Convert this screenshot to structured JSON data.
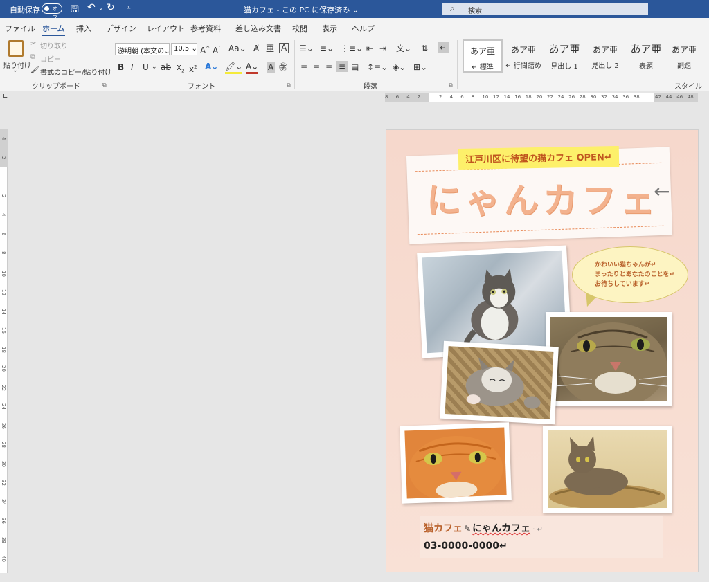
{
  "titlebar": {
    "autosave_label": "自動保存",
    "autosave_toggle": "オフ",
    "document_title": "猫カフェ - この PC に保存済み ⌄",
    "search_placeholder": "検索"
  },
  "tabs": [
    "ファイル",
    "ホーム",
    "挿入",
    "デザイン",
    "レイアウト",
    "参考資料",
    "差し込み文書",
    "校閲",
    "表示",
    "ヘルプ"
  ],
  "ribbon": {
    "clipboard": {
      "paste": "貼り付け",
      "cut": "切り取り",
      "copy": "コピー",
      "format_painter": "書式のコピー/貼り付け",
      "group_label": "クリップボード"
    },
    "font": {
      "font_name": "游明朝 (本文の⌄",
      "font_size": "10.5 ⌄",
      "group_label": "フォント"
    },
    "paragraph": {
      "group_label": "段落"
    },
    "styles": {
      "group_label": "スタイル",
      "items": [
        {
          "preview": "あア亜",
          "name": "↵ 標準"
        },
        {
          "preview": "あア亜",
          "name": "↵ 行間詰め"
        },
        {
          "preview": "あア亜",
          "name": "見出し 1"
        },
        {
          "preview": "あア亜",
          "name": "見出し 2"
        },
        {
          "preview": "あア亜",
          "name": "表題"
        },
        {
          "preview": "あア亜",
          "name": "副題"
        }
      ]
    }
  },
  "document": {
    "subtitle": "江戸川区に待望の猫カフェ OPEN↵",
    "main_title": "にゃんカフェ",
    "speech_bubble": [
      "かわいい猫ちゃんが↵",
      "まったりとあなたのことを↵",
      "お待ちしています↵"
    ],
    "shop_label": "猫カフェ",
    "shop_name": "にゃんカフェ",
    "phone": "03-0000-0000↵"
  },
  "ruler": {
    "horizontal": [
      "8",
      "6",
      "4",
      "2",
      "",
      "2",
      "4",
      "6",
      "8",
      "10",
      "12",
      "14",
      "16",
      "18",
      "20",
      "22",
      "24",
      "26",
      "28",
      "30",
      "32",
      "34",
      "36",
      "38",
      "",
      "42",
      "44",
      "46",
      "48"
    ],
    "vertical": [
      "4",
      "2",
      "",
      "2",
      "4",
      "6",
      "8",
      "10",
      "12",
      "14",
      "16",
      "18",
      "20",
      "22",
      "24",
      "26",
      "28",
      "30",
      "32",
      "34",
      "36",
      "38",
      "40"
    ]
  }
}
